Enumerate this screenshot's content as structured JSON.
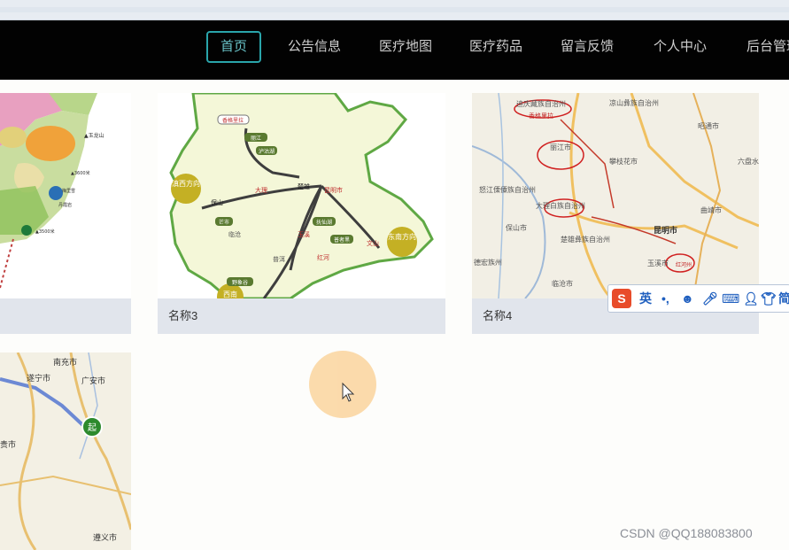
{
  "nav": {
    "items": [
      {
        "label": "首页",
        "active": true
      },
      {
        "label": "公告信息",
        "active": false
      },
      {
        "label": "医疗地图",
        "active": false
      },
      {
        "label": "医疗药品",
        "active": false
      },
      {
        "label": "留言反馈",
        "active": false
      },
      {
        "label": "个人中心",
        "active": false
      },
      {
        "label": "后台管理",
        "active": false
      }
    ]
  },
  "cards": [
    {
      "caption": ""
    },
    {
      "caption": "名称3"
    },
    {
      "caption": "名称4"
    },
    {
      "caption": ""
    }
  ],
  "map_yunnan": {
    "labels": [
      "滇西方向",
      "东南方向",
      "西南",
      "保山",
      "芒市",
      "大理",
      "昆明市",
      "文山",
      "玉溪",
      "红河",
      "抚仙湖",
      "普者黑",
      "香格里拉",
      "丽江",
      "泸沽湖",
      "楚雄",
      "临沧",
      "普洱",
      "野象谷"
    ]
  },
  "map_sichuan": {
    "labels": [
      "凉山彝族自治州",
      "迪庆藏族自治州",
      "香格里拉",
      "丽江市",
      "攀枝花市",
      "昭通市",
      "六盘水",
      "怒江傈僳族自治州",
      "大理白族自治州",
      "昆明市",
      "曲靖市",
      "保山市",
      "楚雄彝族自治州",
      "临沧市",
      "玉溪市",
      "红河州",
      "德宏族州"
    ]
  },
  "map_route": {
    "labels": [
      "南充市",
      "遂宁市",
      "广安市",
      "遵义市",
      "贵市",
      "起"
    ]
  },
  "ime": {
    "lang": "英",
    "brand": "S",
    "mode": "简"
  },
  "watermark": "CSDN @QQ188083800",
  "colors": {
    "nav_bg": "#020202",
    "accent": "#2aa5ab",
    "caption_bg": "#e1e5ec"
  }
}
